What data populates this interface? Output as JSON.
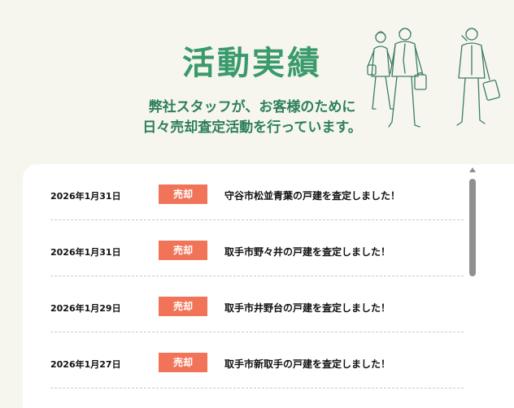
{
  "hero": {
    "title": "活動実績",
    "subtitle_line1": "弊社スタッフが、お客様のために",
    "subtitle_line2": "日々売却査定活動を行っています。"
  },
  "news": [
    {
      "date": "2026年1月31日",
      "badge": "売却",
      "text": "守谷市松並青葉の戸建を査定しました！"
    },
    {
      "date": "2026年1月31日",
      "badge": "売却",
      "text": "取手市野々井の戸建を査定しました！"
    },
    {
      "date": "2026年1月29日",
      "badge": "売却",
      "text": "取手市井野台の戸建を査定しました！"
    },
    {
      "date": "2026年1月27日",
      "badge": "売却",
      "text": "取手市新取手の戸建を査定しました！"
    }
  ],
  "colors": {
    "accent": "#3a9a6c",
    "badge": "#f17459",
    "background": "#f6f6ef"
  }
}
